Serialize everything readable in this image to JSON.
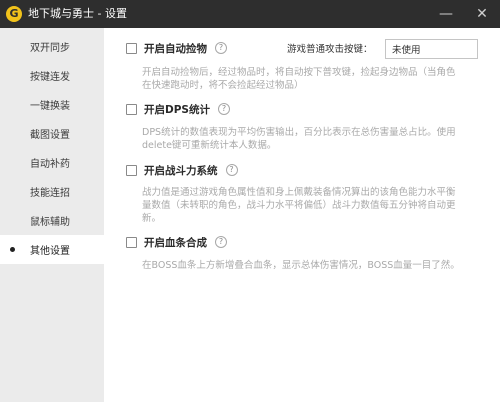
{
  "window": {
    "title": "地下城与勇士 - 设置",
    "logo_glyph": "G",
    "minimize_glyph": "—",
    "close_glyph": "✕"
  },
  "sidebar": {
    "items": [
      {
        "label": "双开同步"
      },
      {
        "label": "按键连发"
      },
      {
        "label": "一键换装"
      },
      {
        "label": "截图设置"
      },
      {
        "label": "自动补药"
      },
      {
        "label": "技能连招"
      },
      {
        "label": "鼠标辅助"
      },
      {
        "label": "其他设置"
      }
    ],
    "active_index": 7
  },
  "options": [
    {
      "label": "开启自动捡物",
      "checked": false,
      "help_glyph": "?",
      "description": "开启自动捡物后，经过物品时，将自动按下普攻键，捡起身边物品（当角色在快速跑动时，将不会捡起经过物品）"
    },
    {
      "label": "开启DPS统计",
      "checked": false,
      "help_glyph": "?",
      "description": "DPS统计的数值表现为平均伤害输出，百分比表示在总伤害量总占比。使用delete键可重新统计本人数据。"
    },
    {
      "label": "开启战斗力系统",
      "checked": false,
      "help_glyph": "?",
      "description": "战力值是通过游戏角色属性值和身上佩戴装备情况算出的该角色能力水平衡量数值（未转职的角色，战斗力水平将偏低）战斗力数值每五分钟将自动更新。"
    },
    {
      "label": "开启血条合成",
      "checked": false,
      "help_glyph": "?",
      "description": "在BOSS血条上方新增叠合血条，显示总体伤害情况，BOSS血量一目了然。"
    }
  ],
  "hotkey": {
    "label": "游戏普通攻击按键：",
    "value": "未使用"
  },
  "colors": {
    "titlebar": "#2e2e2e",
    "sidebar": "#ebebeb",
    "logo": "#f1c21b",
    "description": "#a9a9a9"
  }
}
